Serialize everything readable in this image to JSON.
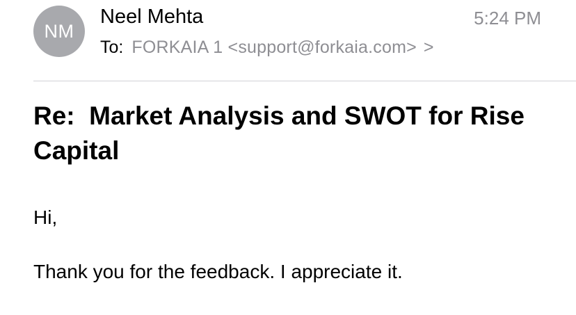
{
  "sender": {
    "initials": "NM",
    "name": "Neel Mehta"
  },
  "timestamp": "5:24 PM",
  "recipient": {
    "label": "To:",
    "value": "FORKAIA 1 <support@forkaia.com>",
    "chevron": "chevron-right-icon"
  },
  "subject": "Re:  Market Analysis and SWOT for Rise Capital",
  "body": {
    "greeting": "Hi,",
    "text": "Thank you for the feedback. I appreciate it."
  }
}
